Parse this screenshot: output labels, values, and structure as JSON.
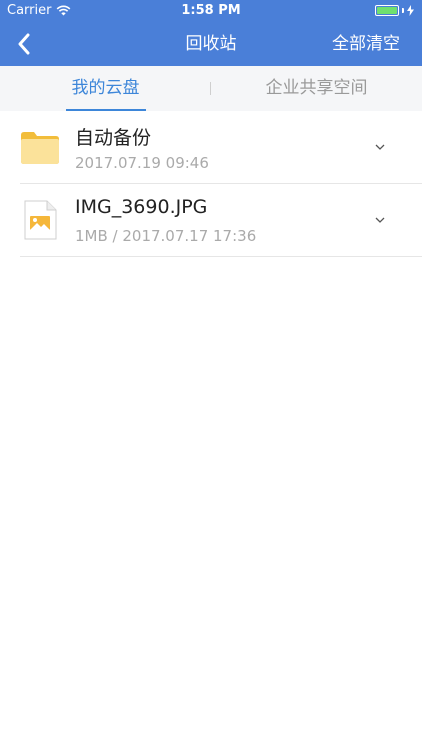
{
  "status_bar": {
    "carrier": "Carrier",
    "time": "1:58 PM"
  },
  "navbar": {
    "title": "回收站",
    "clear_all_label": "全部清空",
    "background": "#4a7fd8"
  },
  "tabs": [
    {
      "label": "我的云盘",
      "active": true
    },
    {
      "label": "企业共享空间",
      "active": false
    }
  ],
  "files": [
    {
      "type": "folder",
      "icon": "folder-icon",
      "name": "自动备份",
      "meta": "2017.07.19 09:46"
    },
    {
      "type": "image",
      "icon": "image-file-icon",
      "name": "IMG_3690.JPG",
      "meta": "1MB / 2017.07.17 17:36"
    }
  ],
  "colors": {
    "accent": "#3d86d9",
    "folder": "#f5c542"
  }
}
